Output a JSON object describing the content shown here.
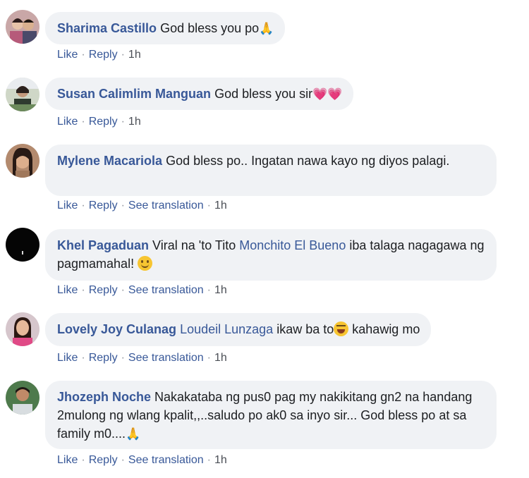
{
  "comments": [
    {
      "author": "Sharima Castillo",
      "text": "God bless you po",
      "emoji": "🙏",
      "actions": {
        "like": "Like",
        "reply": "Reply",
        "time": "1h"
      }
    },
    {
      "author": "Susan Calimlim Manguan",
      "text": "God bless you sir",
      "emoji": "💗💗",
      "actions": {
        "like": "Like",
        "reply": "Reply",
        "time": "1h"
      }
    },
    {
      "author": "Mylene Macariola",
      "text": "God bless po.. Ingatan nawa kayo ng diyos palagi.",
      "actions": {
        "like": "Like",
        "reply": "Reply",
        "translate": "See translation",
        "time": "1h"
      }
    },
    {
      "author": "Khel Pagaduan",
      "text_before": "Viral na 'to Tito",
      "mention": "Monchito El Bueno",
      "text_after": "iba talaga nagagawa ng pagmamahal!",
      "emoji": "smiling-face",
      "actions": {
        "like": "Like",
        "reply": "Reply",
        "translate": "See translation",
        "time": "1h"
      }
    },
    {
      "author": "Lovely Joy Culanag",
      "mention": "Loudeil Lunzaga",
      "text_before": "ikaw ba to",
      "emoji": "laughing-face",
      "text_after": "kahawig mo",
      "actions": {
        "like": "Like",
        "reply": "Reply",
        "translate": "See translation",
        "time": "1h"
      }
    },
    {
      "author": "Jhozeph Noche",
      "text": "Nakakataba ng pus0 pag my nakikitang gn2 na handang 2mulong ng wlang kpalit,,..saludo po ak0 sa inyo sir... God bless po at sa family m0....",
      "emoji": "🙏",
      "actions": {
        "like": "Like",
        "reply": "Reply",
        "translate": "See translation",
        "time": "1h"
      }
    }
  ],
  "colors": {
    "name": "#385898",
    "bubble": "#f0f2f5",
    "meta": "#4b4f56"
  }
}
